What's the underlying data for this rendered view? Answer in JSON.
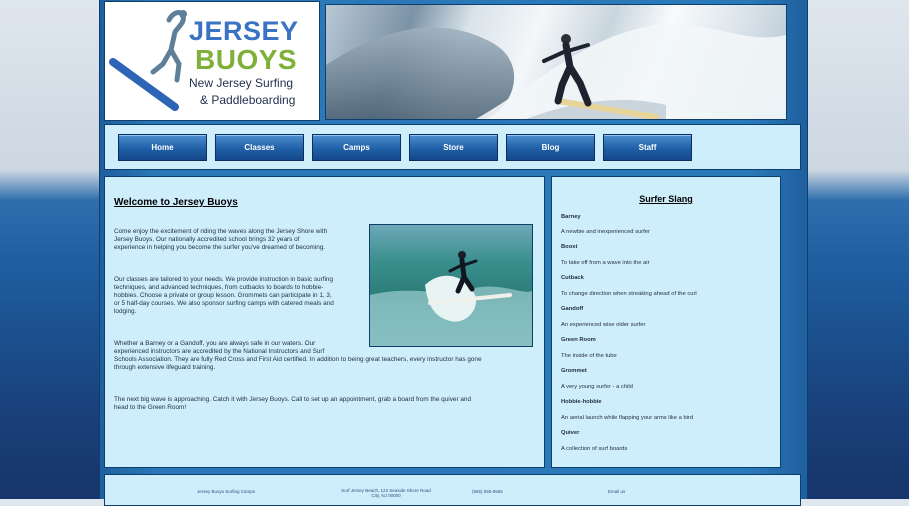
{
  "logo": {
    "line1": "JERSEY",
    "line2": "BUOYS",
    "tagline1": "New Jersey Surfing",
    "tagline2": "& Paddleboarding"
  },
  "nav": {
    "items": [
      "Home",
      "Classes",
      "Camps",
      "Store",
      "Blog",
      "Staff"
    ]
  },
  "main": {
    "heading": "Welcome to Jersey Buoys",
    "p1_lines": [
      "Come enjoy the excitement of riding the waves along the Jersey Shore with",
      "Jersey Buoys. Our nationally accredited school brings 32 years of",
      "experience in helping you become the surfer you've dreamed of becoming."
    ],
    "p2_lines": [
      "Our classes are tailored to your needs. We provide instruction in basic surfing",
      "techniques, and advanced techniques, from cutbacks to boards to hobbie-",
      "hobbies. Choose a private or group lesson. Grommets can participate in 1, 3,",
      "or 5 half-day courses. We also sponsor surfing camps with catered meals and",
      "lodging."
    ],
    "p3_lines": [
      "Whether a Barney or a Gandoff, you are always safe in our waters. Our",
      "experienced instructors are accredited by the National Instructors and Surf",
      "Schools Association. They are fully Red Cross and First Aid certified. In addition to being great teachers, every instructor has gone",
      "through extensive lifeguard training."
    ],
    "p4_lines": [
      "The next big wave is approaching. Catch it with Jersey Buoys. Call to set up an appointment, grab a board from the quiver and",
      "head to the Green Room!"
    ]
  },
  "slang": {
    "title": "Surfer Slang",
    "entries": [
      {
        "term": "Barney",
        "definition": "A newbie and inexperienced surfer"
      },
      {
        "term": "Boost",
        "definition": "To take off from a wave into the air"
      },
      {
        "term": "Cutback",
        "definition": "To change direction when streaking ahead of the curl"
      },
      {
        "term": "Gandoff",
        "definition": "An experienced wise older surfer"
      },
      {
        "term": "Green Room",
        "definition": "The inside of the tube"
      },
      {
        "term": "Grommet",
        "definition": "A very young surfer - a child"
      },
      {
        "term": "Hobbie-hobbie",
        "definition": "An aerial launch while flapping your arms like a bird"
      },
      {
        "term": "Quiver",
        "definition": "A collection of surf boards"
      }
    ]
  },
  "footer": {
    "col1": "Jersey Buoys Surfing Camps",
    "col2a": "Surf Jersey Beach, 123 Seaside Shore Road",
    "col2b": "City, NJ 00000",
    "col3": "(555) 555-5555",
    "col4": "Email us"
  },
  "colors": {
    "accent": "#1f5fa6",
    "panel": "#cfeefc",
    "logo_blue": "#3b73c4",
    "logo_green": "#7fb13a"
  }
}
